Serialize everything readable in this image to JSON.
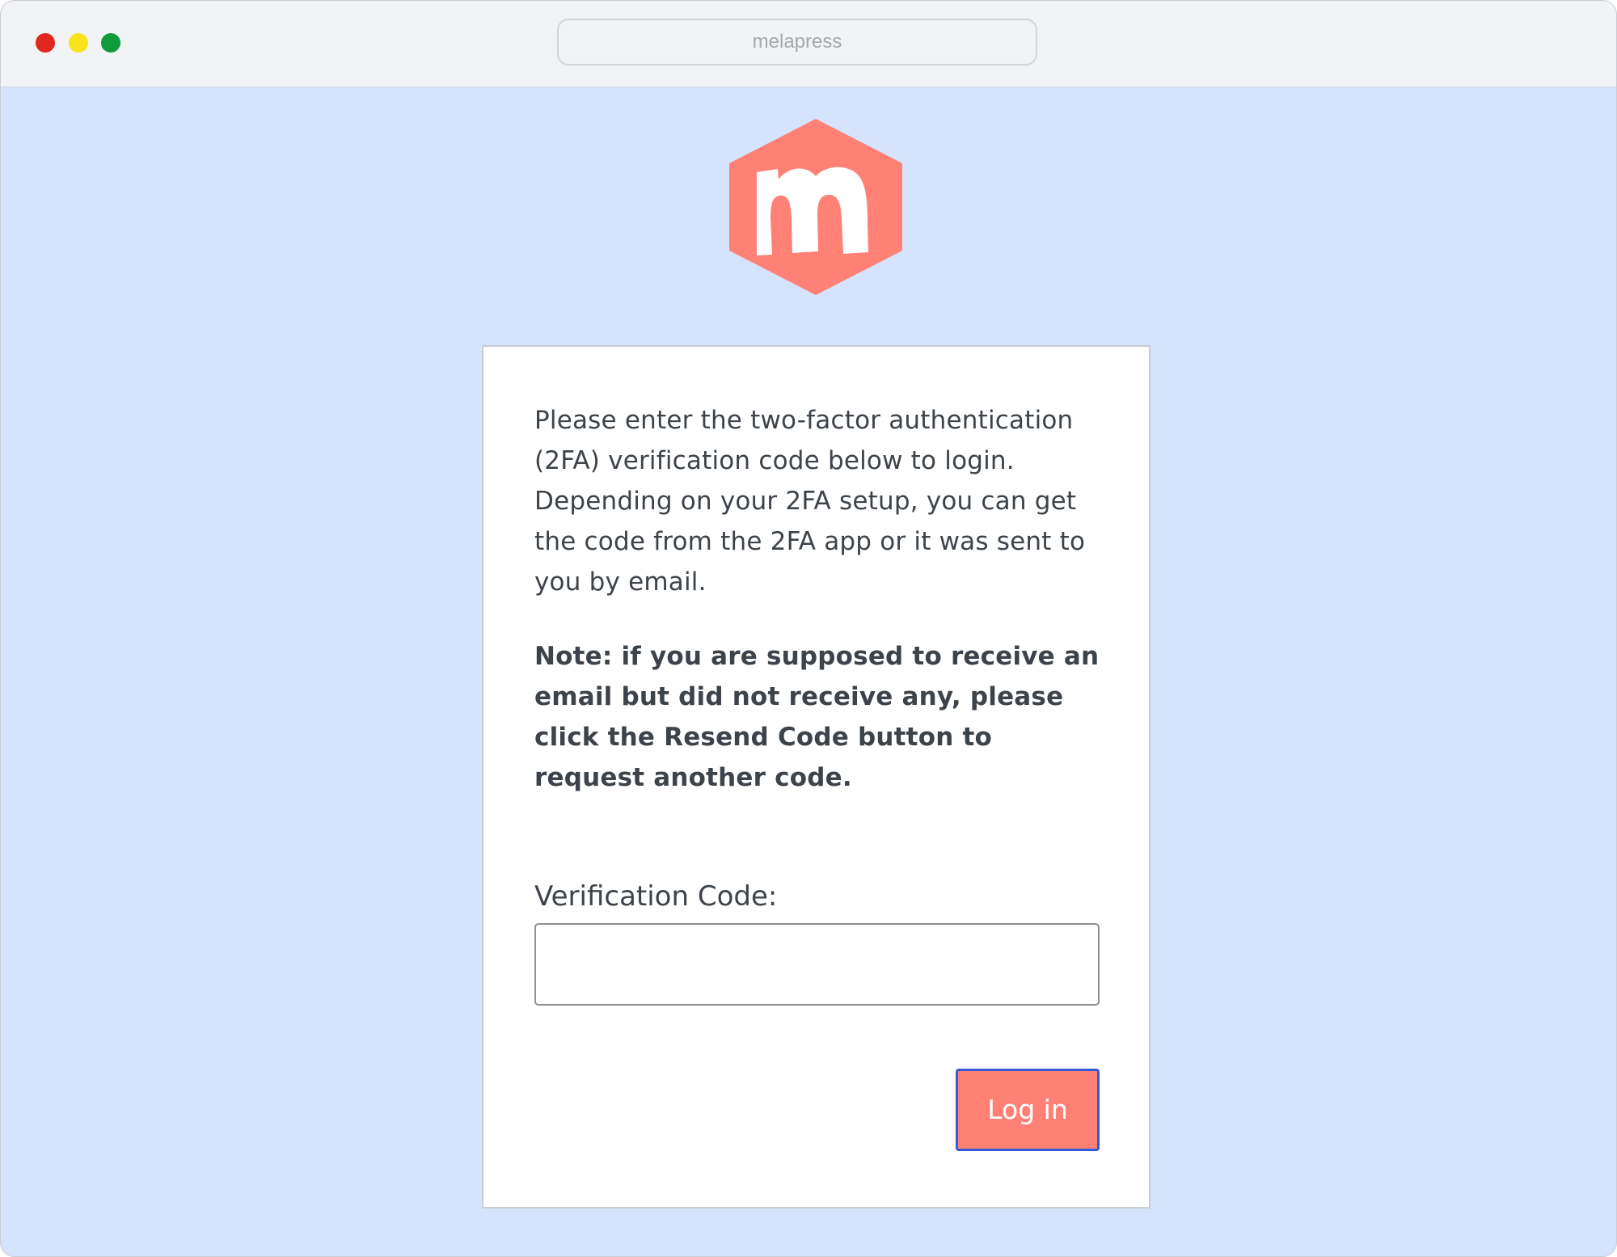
{
  "browser": {
    "address": "melapress"
  },
  "brand": {
    "logo_letter": "m",
    "logo_color": "#ff8175"
  },
  "form": {
    "intro": "Please enter the two-factor authentication (2FA) verification code below to login. Depending on your 2FA setup, you can get the code from the 2FA app or it was sent to you by email.",
    "note": "Note: if you are supposed to receive an email but did not receive any, please click the Resend Code button to request another code.",
    "code_label": "Verification Code:",
    "code_value": "",
    "login_label": "Log in"
  },
  "colors": {
    "background": "#d6e3fd",
    "accent": "#ff8175",
    "button_border": "#3458d6",
    "text": "#3c434a"
  },
  "icons": {
    "close": "red-circle",
    "minimize": "yellow-circle",
    "maximize": "green-circle",
    "logo": "hexagon-m-logo"
  }
}
